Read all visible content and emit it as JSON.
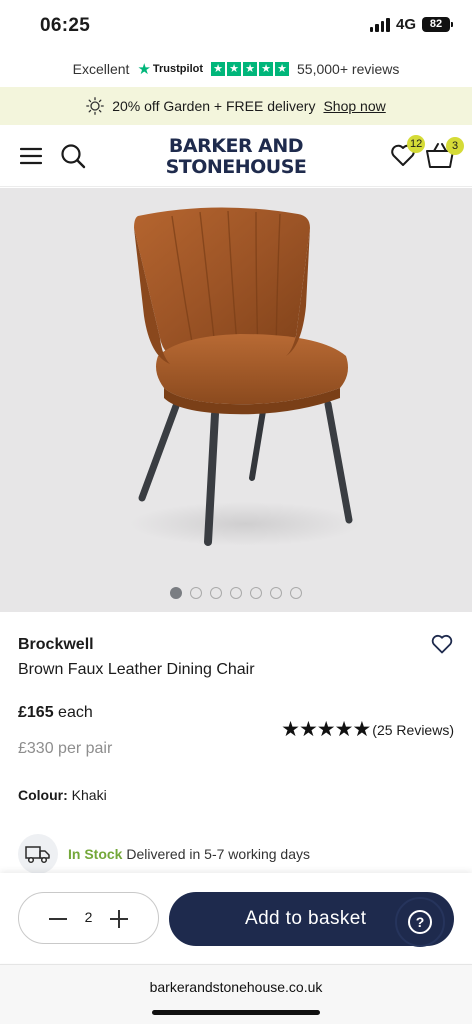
{
  "status_bar": {
    "time": "06:25",
    "network": "4G",
    "battery": "82"
  },
  "trustpilot": {
    "rating_word": "Excellent",
    "brand": "Trustpilot",
    "reviews": "55,000+ reviews"
  },
  "promo": {
    "text": "20% off Garden + FREE delivery",
    "link": "Shop now"
  },
  "header": {
    "logo_line1": "BARKER AND",
    "logo_line2": "STONEHOUSE",
    "wishlist_count": "12",
    "basket_count": "3"
  },
  "gallery": {
    "image_count": 7,
    "active_index": 0
  },
  "product": {
    "brand": "Brockwell",
    "name": "Brown Faux Leather Dining Chair",
    "price": "£165",
    "price_unit": "each",
    "pair_price": "£330 per pair",
    "rating_stars": "★★★★★",
    "reviews": "(25 Reviews)",
    "colour_label": "Colour:",
    "colour_value": "Khaki"
  },
  "stock": {
    "status": "In Stock",
    "delivery": "Delivered in 5-7 working days"
  },
  "basket": {
    "quantity": "2",
    "add_label": "Add to basket",
    "help_label": "?"
  },
  "browser": {
    "url": "barkerandstonehouse.co.uk"
  },
  "colors": {
    "navy": "#1e2a4d",
    "accent": "#d5db37",
    "trustpilot_green": "#00b67a",
    "stock_green": "#74a83a",
    "promo_bg": "#f3f5dc",
    "gallery_bg": "#e7e6e7"
  }
}
